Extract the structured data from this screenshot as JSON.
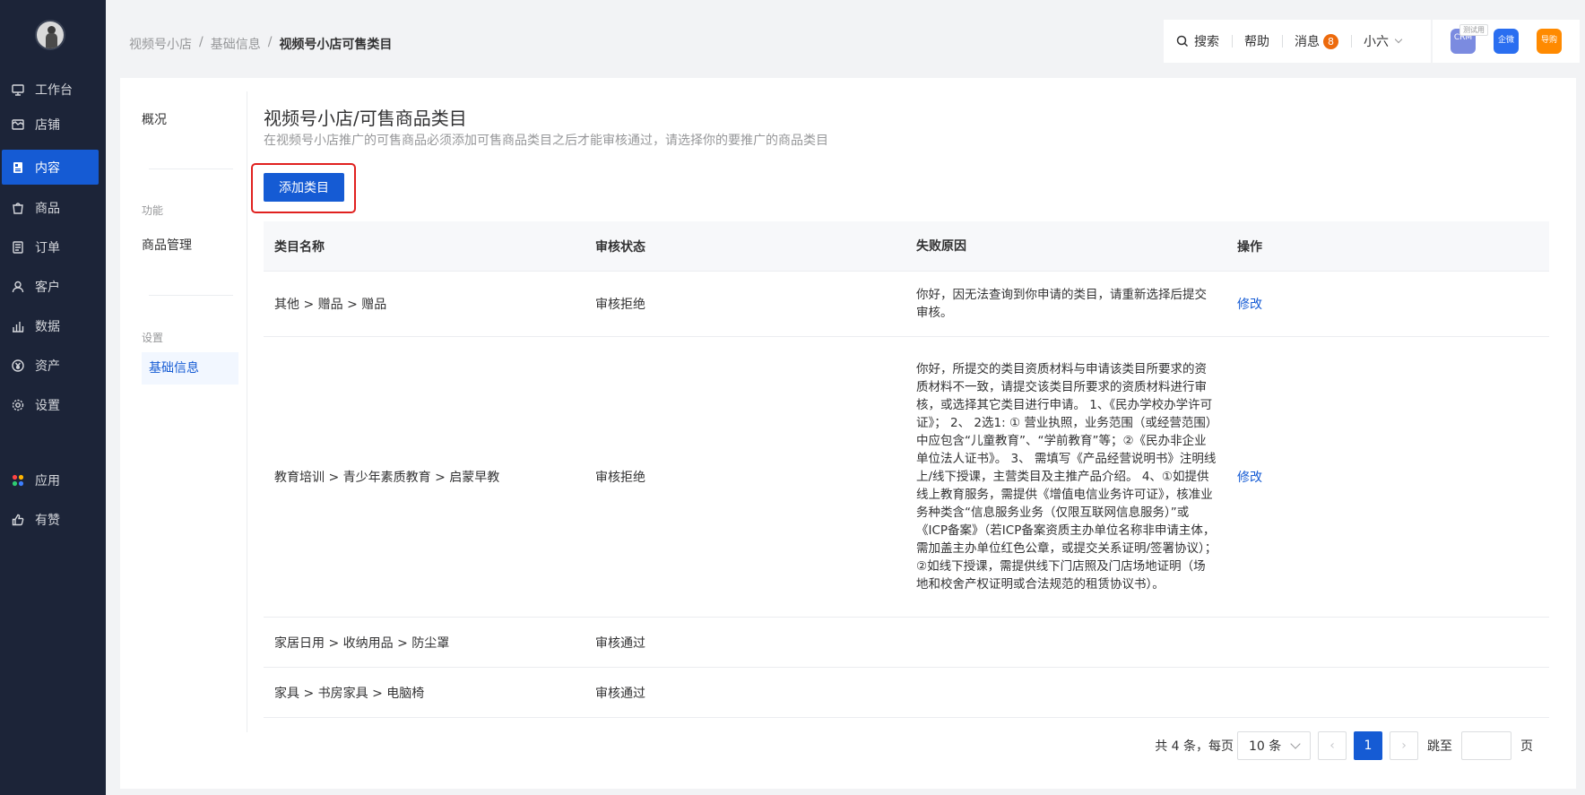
{
  "sidebar": {
    "items": [
      {
        "label": "工作台",
        "icon": "desktop-icon"
      },
      {
        "label": "店铺",
        "icon": "shop-icon"
      },
      {
        "label": "内容",
        "icon": "content-icon",
        "active": true
      },
      {
        "label": "商品",
        "icon": "bag-icon"
      },
      {
        "label": "订单",
        "icon": "order-icon"
      },
      {
        "label": "客户",
        "icon": "user-icon"
      },
      {
        "label": "数据",
        "icon": "chart-icon"
      },
      {
        "label": "资产",
        "icon": "yuan-icon"
      },
      {
        "label": "设置",
        "icon": "gear-icon"
      },
      {
        "label": "应用",
        "icon": "apps-icon"
      },
      {
        "label": "有赞",
        "icon": "thumb-icon"
      }
    ]
  },
  "breadcrumb": {
    "items": [
      "视频号小店",
      "基础信息"
    ],
    "current": "视频号小店可售类目",
    "separator": "/"
  },
  "topbar": {
    "search": "搜索",
    "help": "帮助",
    "messages": "消息",
    "message_count": "8",
    "user": "小六"
  },
  "apps": {
    "trial_tag": "测试用",
    "crm": "CRM",
    "qiwei": "企微",
    "daogou": "导购",
    "colors": {
      "crm": "#7b8be0",
      "qiwei": "#2a6ef0",
      "daogou": "#ff8a00"
    }
  },
  "sec_nav": {
    "overview": "概况",
    "group_function": "功能",
    "product_manage": "商品管理",
    "group_settings": "设置",
    "basic_info": "基础信息"
  },
  "main": {
    "title": "视频号小店/可售商品类目",
    "desc": "在视频号小店推广的可售商品必须添加可售商品类目之后才能审核通过，请选择你的要推广的商品类目",
    "add_button": "添加类目",
    "columns": [
      "类目名称",
      "审核状态",
      "失败原因",
      "操作"
    ],
    "rows": [
      {
        "category": "其他 > 赠品 > 赠品",
        "status": "审核拒绝",
        "reason": "你好，因无法查询到你申请的类目，请重新选择后提交审核。",
        "action": "修改"
      },
      {
        "category": "教育培训 > 青少年素质教育 > 启蒙早教",
        "status": "审核拒绝",
        "reason": "你好，所提交的类目资质材料与申请该类目所要求的资质材料不一致，请提交该类目所要求的资质材料进行审核，或选择其它类目进行申请。 1、《民办学校办学许可证》； 2、 2选1: ① 营业执照，业务范围（或经营范围）中应包含“儿童教育”、“学前教育”等；②《民办非企业单位法人证书》。 3、 需填写《产品经营说明书》注明线上/线下授课，主营类目及主推产品介绍。 4、①如提供线上教育服务，需提供《增值电信业务许可证》，核准业务种类含“信息服务业务（仅限互联网信息服务）”或《ICP备案》（若ICP备案资质主办单位名称非申请主体，需加盖主办单位红色公章，或提交关系证明/签署协议）； ②如线下授课，需提供线下门店照及门店场地证明（场地和校舍产权证明或合法规范的租赁协议书）。",
        "action": "修改"
      },
      {
        "category": "家居日用 > 收纳用品 > 防尘罩",
        "status": "审核通过",
        "reason": "",
        "action": ""
      },
      {
        "category": "家具 > 书房家具 > 电脑椅",
        "status": "审核通过",
        "reason": "",
        "action": ""
      }
    ]
  },
  "pagination": {
    "total_text": "共 4 条，每页",
    "page_size": "10 条",
    "current_page": "1",
    "jump_label": "跳至",
    "page_unit": "页",
    "prev": "‹",
    "next": "›"
  },
  "accent_color": "#155bd4",
  "sidebar_color": "#1c2438"
}
